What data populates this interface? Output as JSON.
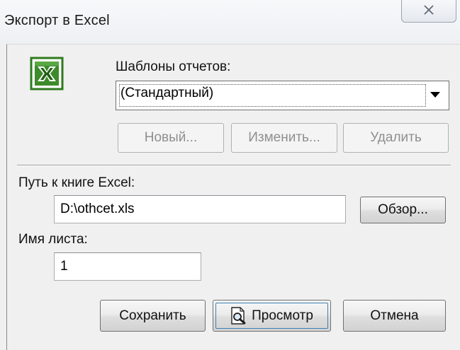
{
  "window": {
    "title": "Экспорт в Excel",
    "close_glyph": "✕"
  },
  "templates": {
    "label": "Шаблоны отчетов:",
    "selected": "(Стандартный)",
    "new_label": "Новый...",
    "edit_label": "Изменить...",
    "delete_label": "Удалить"
  },
  "path": {
    "label": "Путь к книге Excel:",
    "value": "D:\\othcet.xls",
    "browse_label": "Обзор..."
  },
  "sheet": {
    "label": "Имя листа:",
    "value": "1"
  },
  "actions": {
    "save_label": "Сохранить",
    "preview_label": "Просмотр",
    "cancel_label": "Отмена"
  },
  "icons": {
    "app": "excel-icon",
    "preview": "magnifier-page-icon",
    "close": "close-icon",
    "dropdown": "chevron-down-icon"
  },
  "colors": {
    "excel_green": "#2f7a1f",
    "focus_blue": "#3c7fb1",
    "dialog_bg": "#f0f0f0"
  }
}
